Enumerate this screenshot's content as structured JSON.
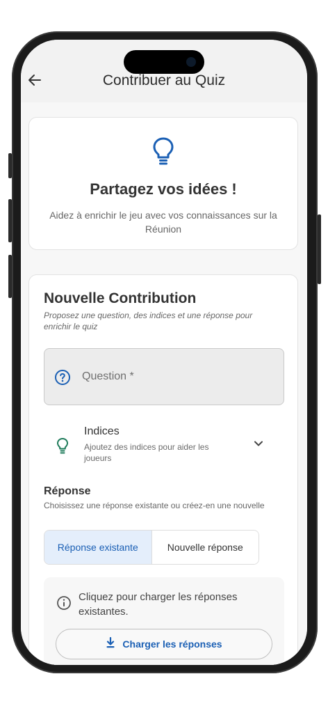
{
  "appbar": {
    "title": "Contribuer au Quiz"
  },
  "intro_card": {
    "heading": "Partagez vos idées !",
    "text": "Aidez à enrichir le jeu avec vos connaissances sur la Réunion"
  },
  "contribution": {
    "title": "Nouvelle Contribution",
    "subtitle": "Proposez une question, des indices et une réponse pour enrichir le quiz",
    "question_placeholder": "Question *",
    "indices": {
      "title": "Indices",
      "subtitle": "Ajoutez des indices pour aider les joueurs"
    },
    "reponse": {
      "title": "Réponse",
      "subtitle": "Choisissez une réponse existante ou créez-en une nouvelle",
      "options": [
        "Réponse existante",
        "Nouvelle réponse"
      ],
      "selected": "Réponse existante"
    },
    "info": {
      "text": "Cliquez pour charger les réponses existantes.",
      "button": "Charger les réponses"
    }
  },
  "colors": {
    "accent": "#1a5fb4",
    "indices_icon": "#1e7b5a",
    "selected_bg": "#e4eefb"
  },
  "icons": [
    "back-arrow-icon",
    "lightbulb-icon",
    "help-circle-icon",
    "chevron-down-icon",
    "info-icon",
    "download-icon"
  ]
}
